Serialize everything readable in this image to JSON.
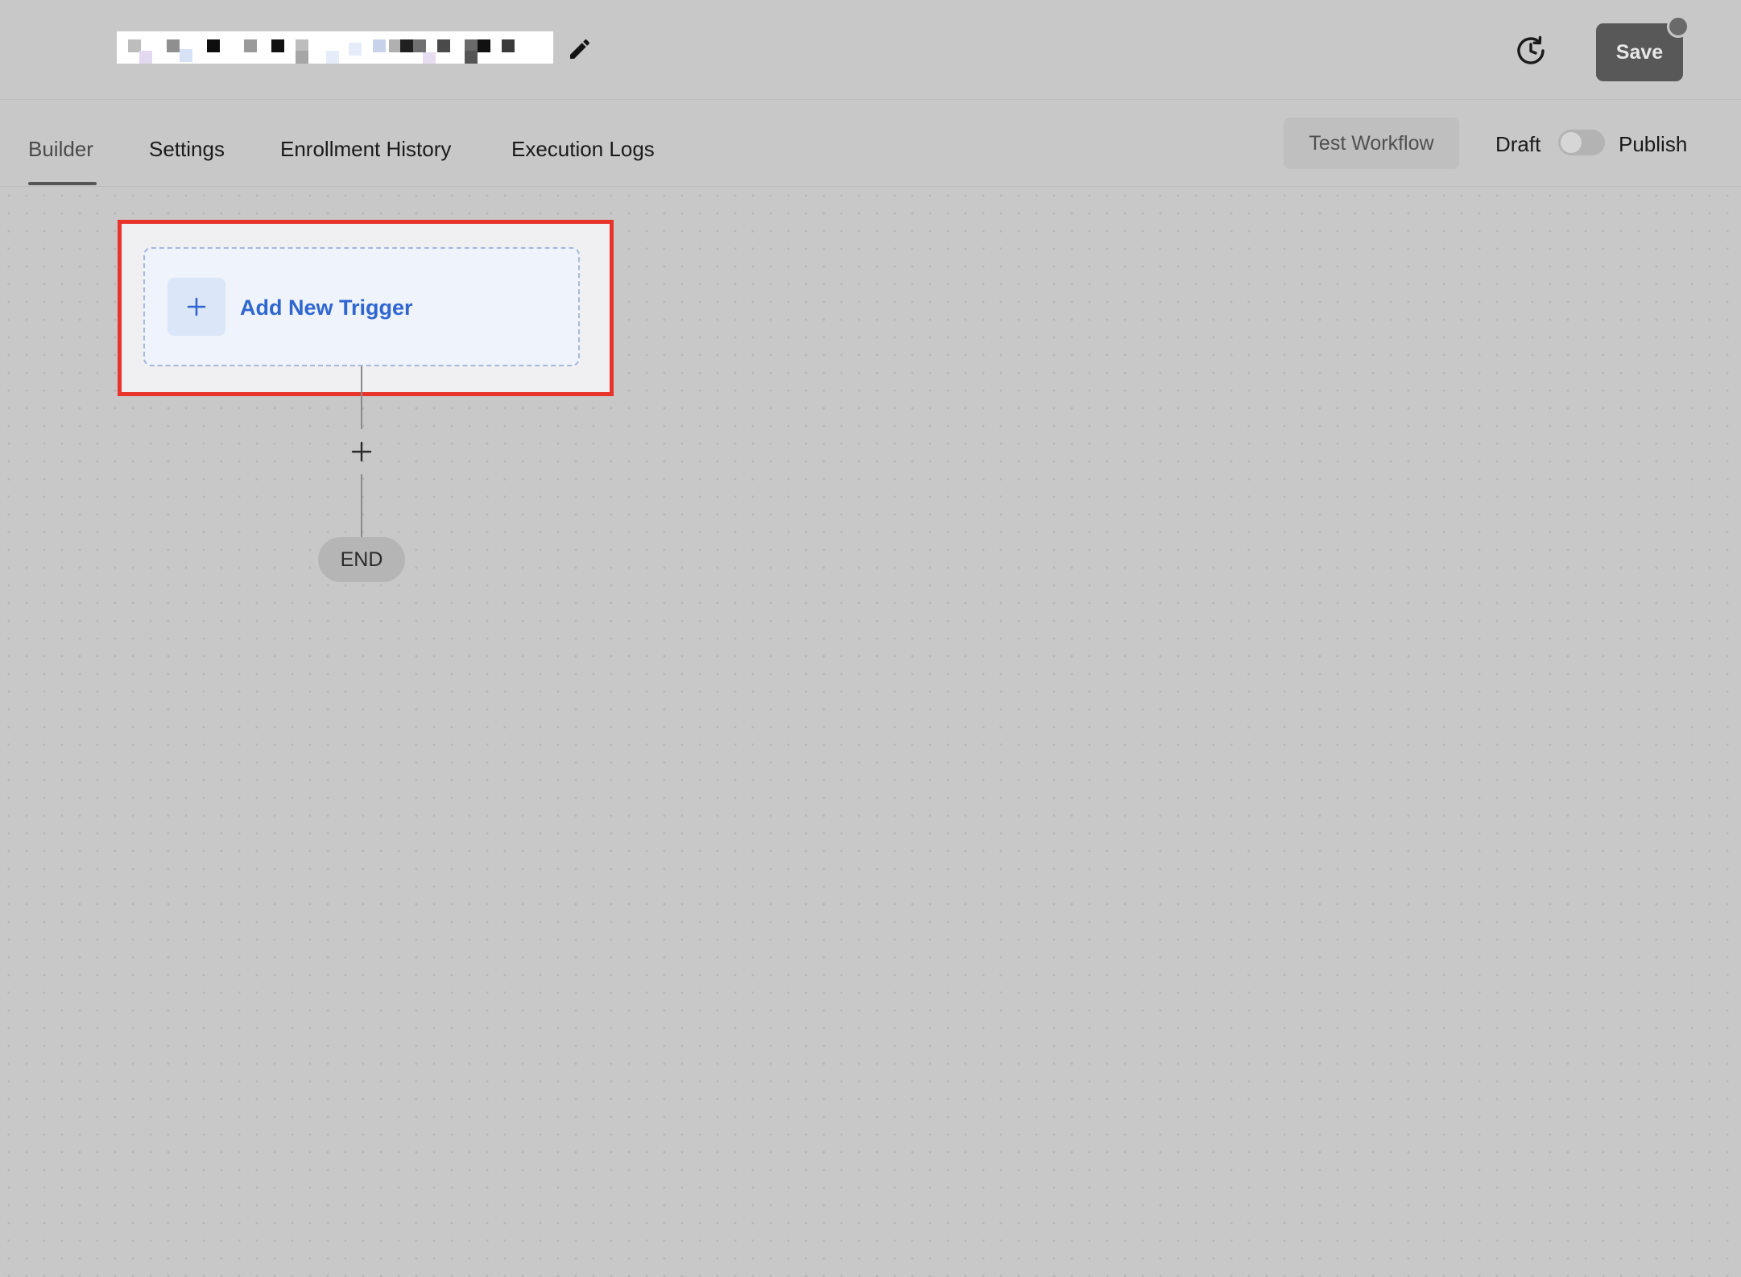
{
  "header": {
    "workflow_title": "",
    "save_label": "Save"
  },
  "tabs": [
    {
      "label": "Builder",
      "active": true
    },
    {
      "label": "Settings",
      "active": false
    },
    {
      "label": "Enrollment History",
      "active": false
    },
    {
      "label": "Execution Logs",
      "active": false
    }
  ],
  "actions": {
    "test_label": "Test Workflow",
    "draft_label": "Draft",
    "publish_label": "Publish",
    "published": false
  },
  "canvas": {
    "trigger_label": "Add New Trigger",
    "end_label": "END"
  },
  "icons": {
    "edit": "pencil-icon",
    "history": "history-clock-icon",
    "trigger_add": "plus-icon",
    "step_add": "plus-icon"
  },
  "colors": {
    "accent": "#2f66d0",
    "highlight": "#e8332a",
    "save_button": "#585858"
  }
}
